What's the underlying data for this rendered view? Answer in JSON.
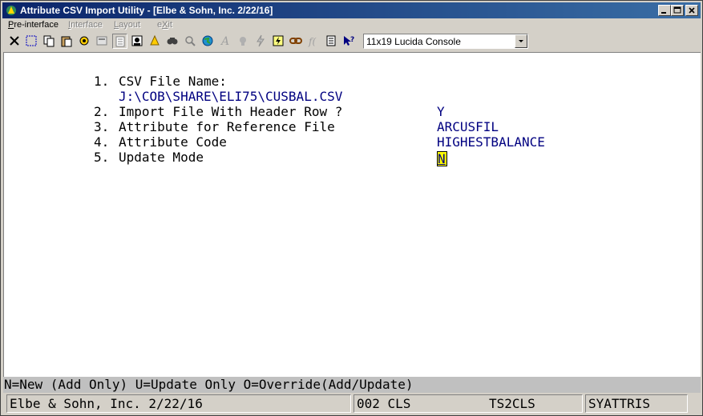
{
  "window": {
    "title": "Attribute CSV Import Utility - [Elbe & Sohn, Inc. 2/22/16]"
  },
  "menu": [
    {
      "label": "Pre-interface",
      "mnemonic": "P",
      "rest": "re-interface",
      "enabled": true
    },
    {
      "label": "Interface",
      "mnemonic": "I",
      "rest": "nterface",
      "enabled": false
    },
    {
      "label": "Layout",
      "mnemonic": "L",
      "rest": "ayout",
      "enabled": false
    },
    {
      "label": "eXit",
      "pre": "e",
      "mnemonic": "X",
      "rest": "it",
      "enabled": false
    }
  ],
  "toolbar": {
    "font_select": "11x19 Lucida Console",
    "icons": [
      "close-x-icon",
      "select-icon",
      "copy-icon",
      "paste-icon",
      "settings-icon",
      "properties-icon",
      "list-icon",
      "user-lookup-icon",
      "bell-icon",
      "find-icon",
      "zoom-icon",
      "globe-icon",
      "font-a-icon",
      "font-style-icon",
      "lightning-icon",
      "macro-icon",
      "link-icon",
      "function-icon",
      "notes-icon",
      "help-pointer-icon"
    ],
    "colors": {
      "window_bg": "#d4d0c8",
      "titlebar": "#0a246a"
    }
  },
  "form": {
    "fields": [
      {
        "num": "1.",
        "label": "CSV File Name:",
        "value": "J:\\COB\\SHARE\\ELI75\\CUSBAL.CSV"
      },
      {
        "num": "2.",
        "label": "Import File With Header Row ?",
        "value": "Y"
      },
      {
        "num": "3.",
        "label": "Attribute for Reference File",
        "value": "ARCUSFIL"
      },
      {
        "num": "4.",
        "label": "Attribute Code",
        "value": "HIGHESTBALANCE"
      },
      {
        "num": "5.",
        "label": "Update Mode",
        "value": "N"
      }
    ],
    "colors": {
      "value": "#000080",
      "cursor": "#ffff00"
    }
  },
  "help_line": "N=New (Add Only) U=Update Only O=Override(Add/Update)",
  "status": {
    "company": "Elbe & Sohn, Inc. 2/22/16",
    "session": "002 CLS",
    "terminal": "TS2CLS",
    "program": "SYATTRIS"
  }
}
